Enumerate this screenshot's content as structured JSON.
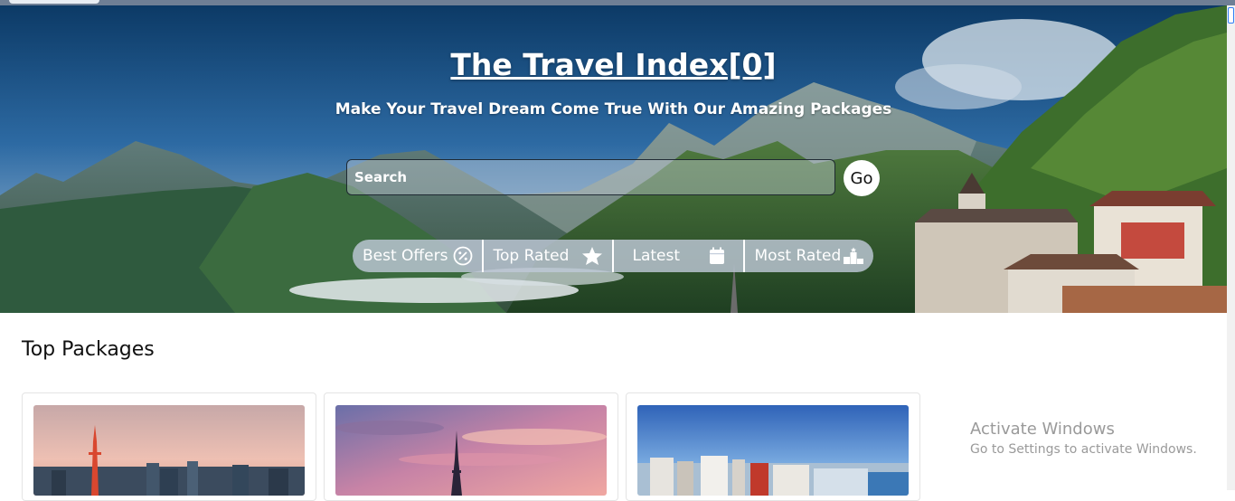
{
  "hero": {
    "title": "The Travel Index[0]",
    "subtitle": "Make Your Travel Dream Come True With Our Amazing Packages",
    "search_placeholder": "Search",
    "go_label": "Go"
  },
  "filters": [
    {
      "label": "Best Offers",
      "icon": "discount-badge-icon"
    },
    {
      "label": "Top Rated",
      "icon": "star-icon"
    },
    {
      "label": "Latest",
      "icon": "calendar-icon"
    },
    {
      "label": "Most Rated",
      "icon": "podium-icon"
    }
  ],
  "section": {
    "title": "Top Packages"
  },
  "packages": [
    {
      "image": "tokyo-skyline-image"
    },
    {
      "image": "paris-eiffel-tower-image"
    },
    {
      "image": "seaside-city-image"
    }
  ],
  "watermark": {
    "line1": "Activate Windows",
    "line2": "Go to Settings to activate Windows."
  }
}
